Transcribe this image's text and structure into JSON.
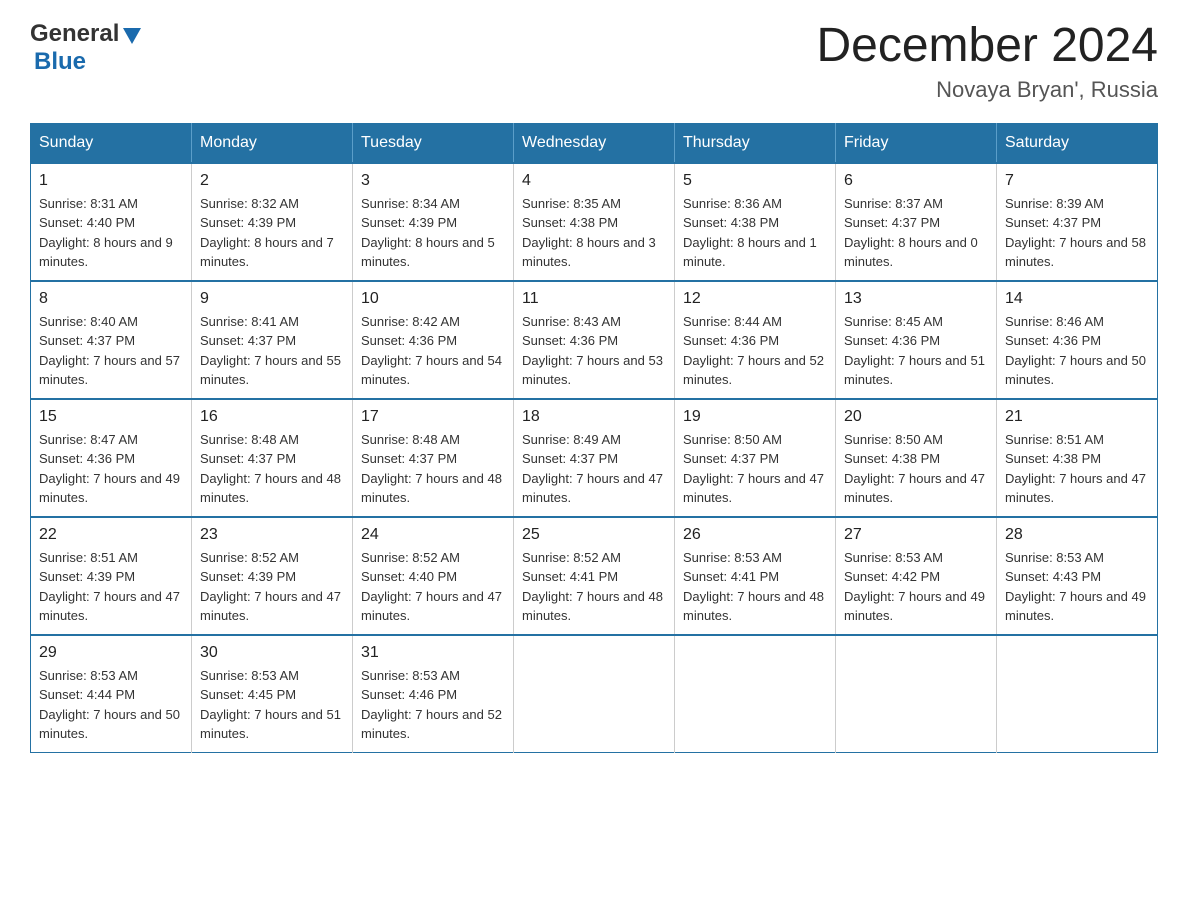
{
  "header": {
    "logo_general": "General",
    "logo_blue": "Blue",
    "title": "December 2024",
    "subtitle": "Novaya Bryan', Russia"
  },
  "calendar": {
    "days_of_week": [
      "Sunday",
      "Monday",
      "Tuesday",
      "Wednesday",
      "Thursday",
      "Friday",
      "Saturday"
    ],
    "weeks": [
      [
        {
          "day": "1",
          "sunrise": "8:31 AM",
          "sunset": "4:40 PM",
          "daylight": "8 hours and 9 minutes."
        },
        {
          "day": "2",
          "sunrise": "8:32 AM",
          "sunset": "4:39 PM",
          "daylight": "8 hours and 7 minutes."
        },
        {
          "day": "3",
          "sunrise": "8:34 AM",
          "sunset": "4:39 PM",
          "daylight": "8 hours and 5 minutes."
        },
        {
          "day": "4",
          "sunrise": "8:35 AM",
          "sunset": "4:38 PM",
          "daylight": "8 hours and 3 minutes."
        },
        {
          "day": "5",
          "sunrise": "8:36 AM",
          "sunset": "4:38 PM",
          "daylight": "8 hours and 1 minute."
        },
        {
          "day": "6",
          "sunrise": "8:37 AM",
          "sunset": "4:37 PM",
          "daylight": "8 hours and 0 minutes."
        },
        {
          "day": "7",
          "sunrise": "8:39 AM",
          "sunset": "4:37 PM",
          "daylight": "7 hours and 58 minutes."
        }
      ],
      [
        {
          "day": "8",
          "sunrise": "8:40 AM",
          "sunset": "4:37 PM",
          "daylight": "7 hours and 57 minutes."
        },
        {
          "day": "9",
          "sunrise": "8:41 AM",
          "sunset": "4:37 PM",
          "daylight": "7 hours and 55 minutes."
        },
        {
          "day": "10",
          "sunrise": "8:42 AM",
          "sunset": "4:36 PM",
          "daylight": "7 hours and 54 minutes."
        },
        {
          "day": "11",
          "sunrise": "8:43 AM",
          "sunset": "4:36 PM",
          "daylight": "7 hours and 53 minutes."
        },
        {
          "day": "12",
          "sunrise": "8:44 AM",
          "sunset": "4:36 PM",
          "daylight": "7 hours and 52 minutes."
        },
        {
          "day": "13",
          "sunrise": "8:45 AM",
          "sunset": "4:36 PM",
          "daylight": "7 hours and 51 minutes."
        },
        {
          "day": "14",
          "sunrise": "8:46 AM",
          "sunset": "4:36 PM",
          "daylight": "7 hours and 50 minutes."
        }
      ],
      [
        {
          "day": "15",
          "sunrise": "8:47 AM",
          "sunset": "4:36 PM",
          "daylight": "7 hours and 49 minutes."
        },
        {
          "day": "16",
          "sunrise": "8:48 AM",
          "sunset": "4:37 PM",
          "daylight": "7 hours and 48 minutes."
        },
        {
          "day": "17",
          "sunrise": "8:48 AM",
          "sunset": "4:37 PM",
          "daylight": "7 hours and 48 minutes."
        },
        {
          "day": "18",
          "sunrise": "8:49 AM",
          "sunset": "4:37 PM",
          "daylight": "7 hours and 47 minutes."
        },
        {
          "day": "19",
          "sunrise": "8:50 AM",
          "sunset": "4:37 PM",
          "daylight": "7 hours and 47 minutes."
        },
        {
          "day": "20",
          "sunrise": "8:50 AM",
          "sunset": "4:38 PM",
          "daylight": "7 hours and 47 minutes."
        },
        {
          "day": "21",
          "sunrise": "8:51 AM",
          "sunset": "4:38 PM",
          "daylight": "7 hours and 47 minutes."
        }
      ],
      [
        {
          "day": "22",
          "sunrise": "8:51 AM",
          "sunset": "4:39 PM",
          "daylight": "7 hours and 47 minutes."
        },
        {
          "day": "23",
          "sunrise": "8:52 AM",
          "sunset": "4:39 PM",
          "daylight": "7 hours and 47 minutes."
        },
        {
          "day": "24",
          "sunrise": "8:52 AM",
          "sunset": "4:40 PM",
          "daylight": "7 hours and 47 minutes."
        },
        {
          "day": "25",
          "sunrise": "8:52 AM",
          "sunset": "4:41 PM",
          "daylight": "7 hours and 48 minutes."
        },
        {
          "day": "26",
          "sunrise": "8:53 AM",
          "sunset": "4:41 PM",
          "daylight": "7 hours and 48 minutes."
        },
        {
          "day": "27",
          "sunrise": "8:53 AM",
          "sunset": "4:42 PM",
          "daylight": "7 hours and 49 minutes."
        },
        {
          "day": "28",
          "sunrise": "8:53 AM",
          "sunset": "4:43 PM",
          "daylight": "7 hours and 49 minutes."
        }
      ],
      [
        {
          "day": "29",
          "sunrise": "8:53 AM",
          "sunset": "4:44 PM",
          "daylight": "7 hours and 50 minutes."
        },
        {
          "day": "30",
          "sunrise": "8:53 AM",
          "sunset": "4:45 PM",
          "daylight": "7 hours and 51 minutes."
        },
        {
          "day": "31",
          "sunrise": "8:53 AM",
          "sunset": "4:46 PM",
          "daylight": "7 hours and 52 minutes."
        },
        null,
        null,
        null,
        null
      ]
    ]
  }
}
